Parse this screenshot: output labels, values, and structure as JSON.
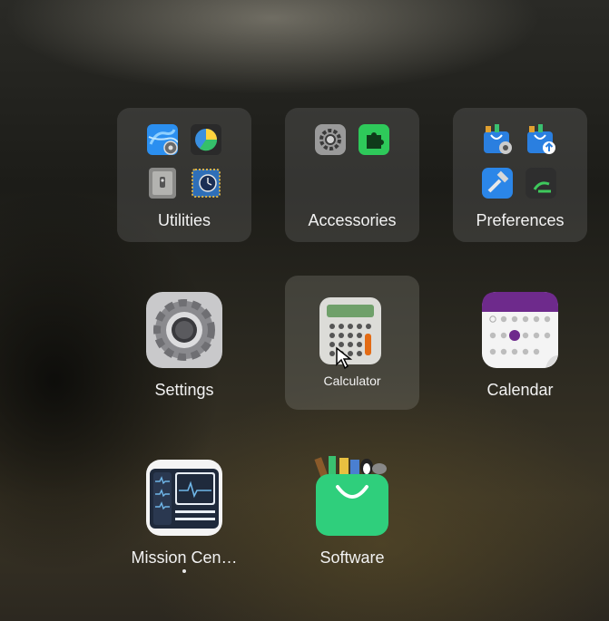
{
  "folders": [
    {
      "name": "Utilities",
      "apps": [
        "network-globe-icon",
        "disk-usage-icon",
        "safe-vault-icon",
        "system-monitor-chip-icon"
      ]
    },
    {
      "name": "Accessories",
      "apps": [
        "gear-settings-icon",
        "extensions-puzzle-icon"
      ]
    },
    {
      "name": "Preferences",
      "apps": [
        "software-bag-gear-icon",
        "software-bag-update-icon",
        "developer-hammer-icon",
        "terminal-green-icon"
      ]
    }
  ],
  "apps": [
    {
      "name": "Settings",
      "icon": "settings-gear-icon"
    },
    {
      "name": "Calculator",
      "icon": "calculator-icon",
      "hovered": true
    },
    {
      "name": "Calendar",
      "icon": "calendar-icon"
    },
    {
      "name": "Mission Cen…",
      "icon": "mission-center-icon"
    },
    {
      "name": "Software",
      "icon": "software-bag-icon"
    }
  ],
  "colors": {
    "accent_purple": "#6e2a8c",
    "software_green": "#2fcf7c",
    "folder_bg": "rgba(120,120,120,0.28)"
  }
}
